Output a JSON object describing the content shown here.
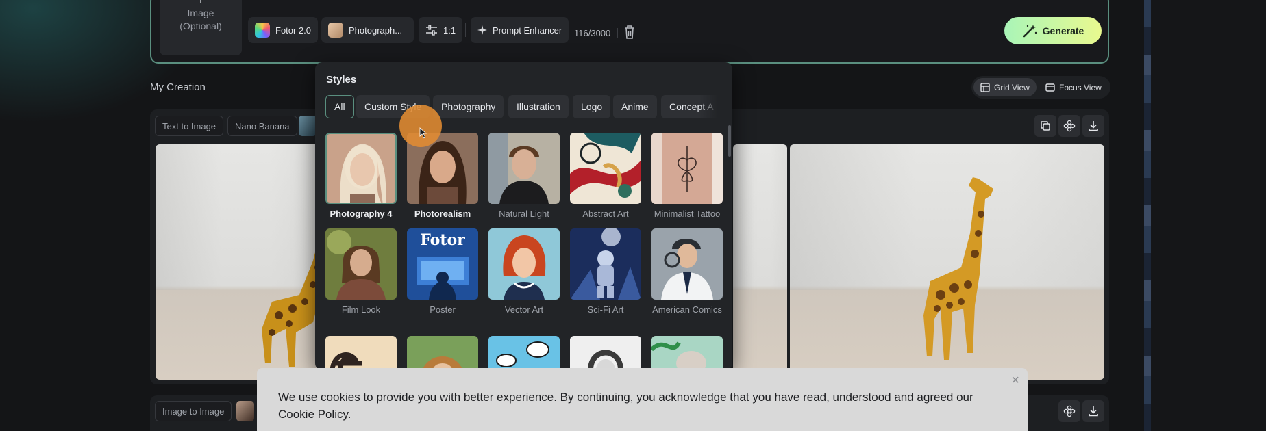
{
  "composer": {
    "image_upload": {
      "plus": "+",
      "label_line1": "Image",
      "label_line2": "(Optional)"
    },
    "model_chip": "Fotor 2.0",
    "style_chip": "Photograph...",
    "ratio_chip": "1:1",
    "prompt_enhancer": "Prompt Enhancer",
    "char_count": "116/3000",
    "generate": "Generate"
  },
  "creation": {
    "title": "My Creation",
    "grid_view": "Grid View",
    "focus_view": "Focus View",
    "tags": [
      "Text to Image",
      "Nano Banana"
    ],
    "row2_tag": "Image to Image"
  },
  "styles": {
    "title": "Styles",
    "categories": [
      "All",
      "Custom Style",
      "Photography",
      "Illustration",
      "Logo",
      "Anime",
      "Concept A"
    ],
    "active_category": "All",
    "items": [
      {
        "label": "Photography 4"
      },
      {
        "label": "Photorealism"
      },
      {
        "label": "Natural Light"
      },
      {
        "label": "Abstract Art"
      },
      {
        "label": "Minimalist Tattoo"
      },
      {
        "label": "Film Look"
      },
      {
        "label": "Poster",
        "poster_text": "Fotor"
      },
      {
        "label": "Vector Art"
      },
      {
        "label": "Sci-Fi Art"
      },
      {
        "label": "American Comics"
      }
    ],
    "selected": "Photography 4"
  },
  "cookie": {
    "close": "×",
    "text": "We use cookies to provide you with better experience. By continuing, you acknowledge that you have read, understood and agreed our",
    "link": "Cookie Policy",
    "end": "."
  },
  "colors": {
    "accent": "#5a8f7f",
    "generate_start": "#a9f5b8",
    "generate_end": "#e9f98f",
    "cursor_highlight": "#e28c32"
  }
}
